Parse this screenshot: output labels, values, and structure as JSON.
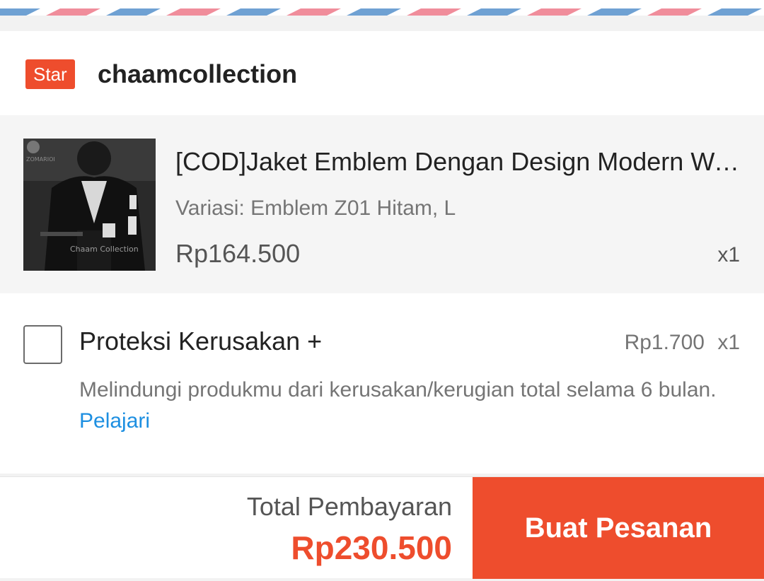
{
  "colors": {
    "accent": "#ee4d2d",
    "link": "#1d8fe1",
    "stripe_blue": "#6fa1d3",
    "stripe_pink": "#f08d9b"
  },
  "shop": {
    "badge": "Star",
    "name": "chaamcollection"
  },
  "product": {
    "title": "[COD]Jaket Emblem Dengan Design Modern Wanita/Pria",
    "variant": "Variasi: Emblem Z01 Hitam, L",
    "price": "Rp164.500",
    "qty": "x1",
    "image_watermark": "Chaam Collection",
    "image_brand": "ZOMARIOI"
  },
  "protection": {
    "title": "Proteksi Kerusakan +",
    "price": "Rp1.700",
    "qty": "x1",
    "description": "Melindungi produkmu dari kerusakan/kerugian total selama 6 bulan.",
    "link_label": "Pelajari",
    "checked": false
  },
  "footer": {
    "total_label": "Total Pembayaran",
    "total_amount": "Rp230.500",
    "order_button_label": "Buat Pesanan"
  }
}
